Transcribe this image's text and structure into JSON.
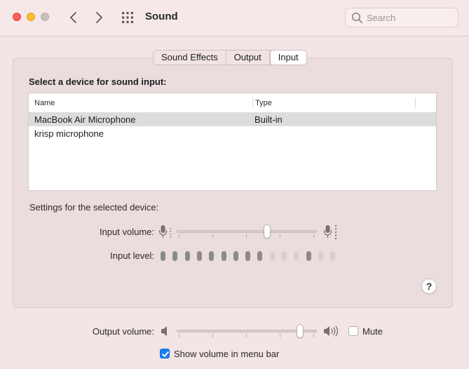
{
  "window": {
    "title": "Sound",
    "search_placeholder": "Search"
  },
  "tabs": [
    {
      "label": "Sound Effects",
      "active": false
    },
    {
      "label": "Output",
      "active": false
    },
    {
      "label": "Input",
      "active": true
    }
  ],
  "input_panel": {
    "section_title": "Select a device for sound input:",
    "columns": [
      "Name",
      "Type"
    ],
    "devices": [
      {
        "name": "MacBook Air Microphone",
        "type": "Built-in",
        "selected": true
      },
      {
        "name": "krisp microphone",
        "type": "",
        "selected": false
      }
    ],
    "settings_label": "Settings for the selected device:",
    "input_volume_label": "Input volume:",
    "input_volume_value": 0.65,
    "input_level_label": "Input level:",
    "input_level_segments": 15,
    "input_level_active": 9,
    "help_label": "?"
  },
  "output": {
    "volume_label": "Output volume:",
    "volume_value": 0.9,
    "mute_label": "Mute",
    "mute_checked": false,
    "menu_bar_label": "Show volume in menu bar",
    "menu_bar_checked": true
  },
  "colors": {
    "accent": "#1a7ff0",
    "level_active": "#8a8a8a",
    "level_inactive": "#d8cfd0"
  },
  "icons": {
    "back": "chevron-left-icon",
    "forward": "chevron-right-icon",
    "grid": "grid-icon",
    "search": "search-icon",
    "mic_low": "microphone-low-icon",
    "mic_high": "microphone-high-icon",
    "speaker_low": "speaker-low-icon",
    "speaker_high": "speaker-high-icon"
  }
}
